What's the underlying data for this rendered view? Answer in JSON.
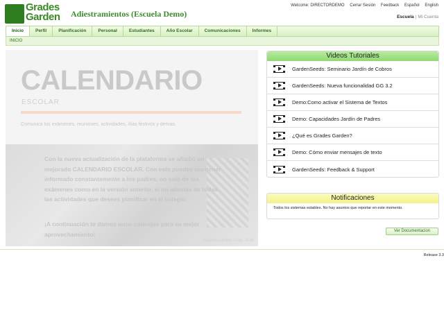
{
  "header": {
    "logo_line1": "Grades",
    "logo_line2": "Garden",
    "org_title": "Adiestramientos (Escuela Demo)",
    "welcome": "Welcome: DIRECTORDEMO",
    "logout": "Cerrar Sesión",
    "feedback": "Feedback",
    "lang_es": "Español",
    "lang_en": "English",
    "school_current": "Escuela",
    "school_sep": "|",
    "school_other": "Mi Cuenta"
  },
  "nav": {
    "items": [
      {
        "label": "Inicio"
      },
      {
        "label": "Perfil"
      },
      {
        "label": "Planificación"
      },
      {
        "label": "Personal"
      },
      {
        "label": "Estudiantes"
      },
      {
        "label": "Año Escolar"
      },
      {
        "label": "Comunicaciones"
      },
      {
        "label": "Informes"
      }
    ]
  },
  "breadcrumb": "INICIO",
  "banner": {
    "title": "CALENDARIO",
    "subtitle": "ESCOLAR",
    "description": "Comunica tus exámenes, reuniones, actividades, días festivos y demas.",
    "body": "Con la nueva actualización de la plataforma se añadió un mejorado CALENDARIO ESCOLAR. Con este puedes mantener informado constantemente a los padres, no solo de los exámenes como en la versión anterior, si no además de todas las actividades que desees planificar en el colegio.",
    "cta": "¡A continuación te damos unos consejos para su mejor aprovechamiento!",
    "credit": "Grades Garden Corp. 2016"
  },
  "videos": {
    "title": "Videos Tutoriales",
    "items": [
      {
        "label": "GardenSeeds: Seminario Jardín de Cobros"
      },
      {
        "label": "GardenSeeds: Nueva funcionalidad GG 3.2"
      },
      {
        "label": "Demo:Como activar el Sistema de Textos"
      },
      {
        "label": "Demo: Capacidades Jardín de Padres"
      },
      {
        "label": "¿Qué es Grades Garden?"
      },
      {
        "label": "Demo: Cómo enviar mensajes de texto"
      },
      {
        "label": "GardenSeeds: Feedback & Support"
      }
    ]
  },
  "notifications": {
    "title": "Notificaciones",
    "text": "Todos los sistemas estables. No hay asuntos que reportar en este momento."
  },
  "doc_button": "Ver Documentacion",
  "release": "Release 3.3",
  "colors": {
    "brand_green": "#3a8a26",
    "video_header": "#8fd972",
    "notif_header": "#f2f28a"
  }
}
